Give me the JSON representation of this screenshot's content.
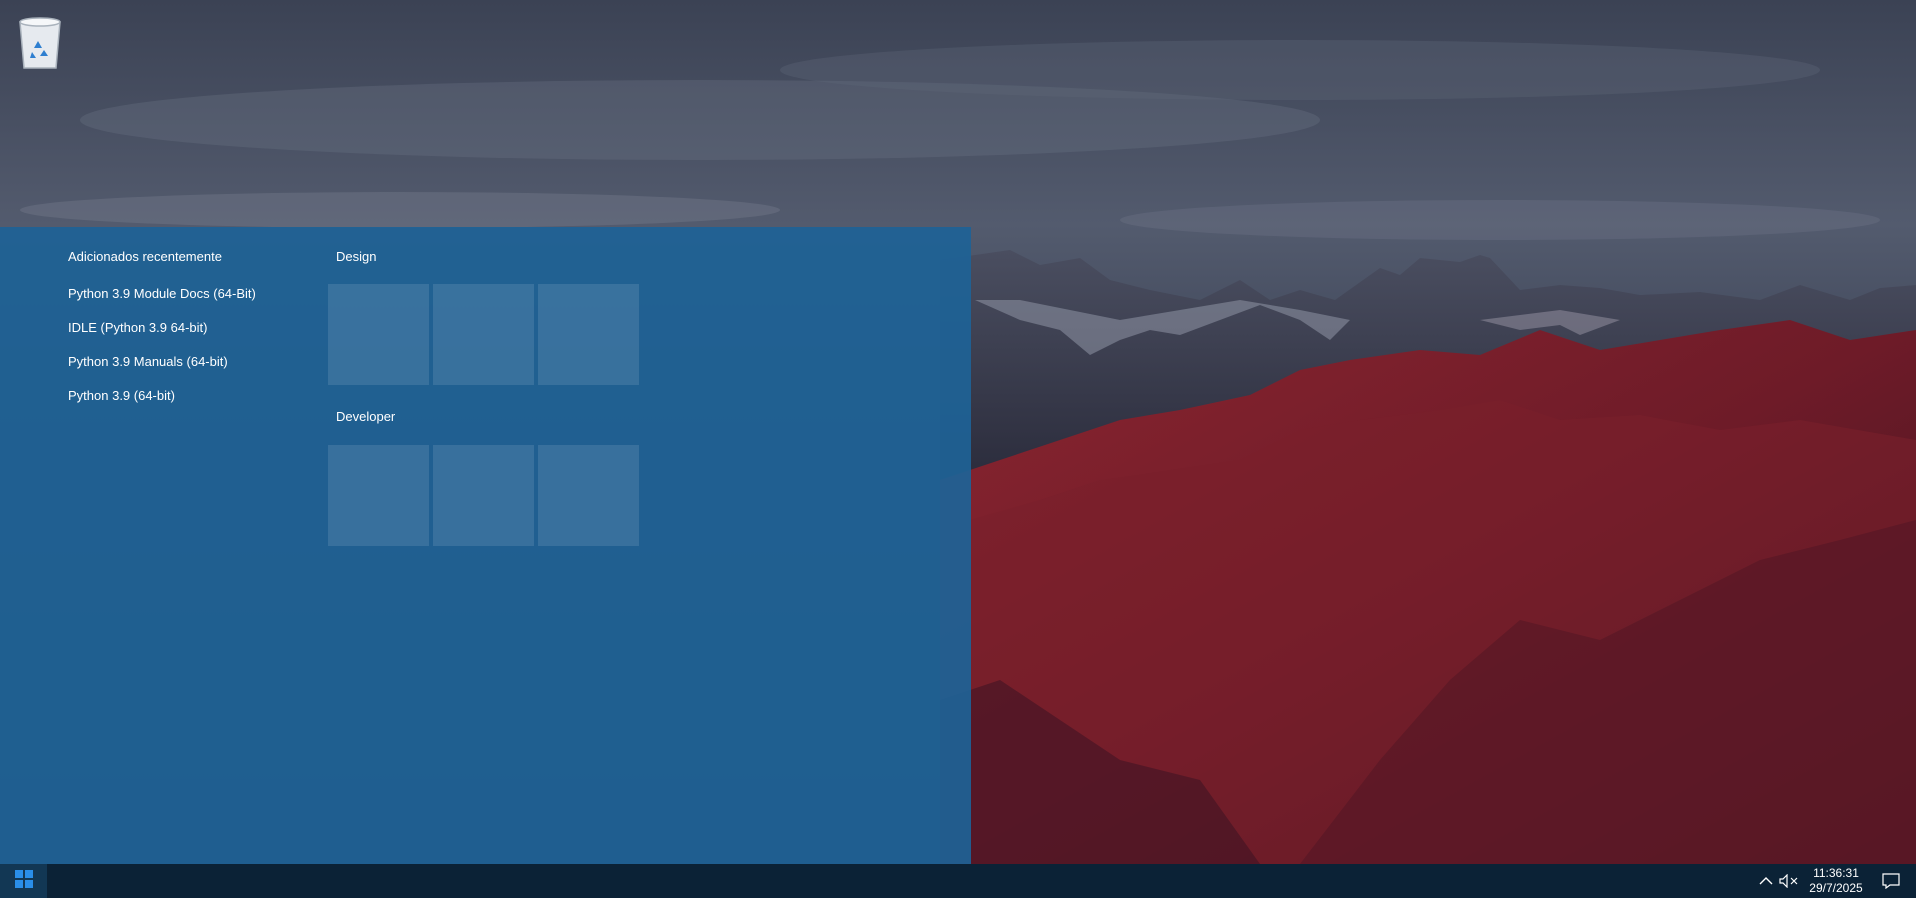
{
  "desktop": {
    "icons": [
      {
        "name": "recycle-bin",
        "icon": "recycle-bin-icon"
      }
    ]
  },
  "start_menu": {
    "recent_header": "Adicionados recentemente",
    "recent_items": [
      {
        "label": "Python 3.9 Module Docs (64-Bit)"
      },
      {
        "label": "IDLE (Python 3.9 64-bit)"
      },
      {
        "label": "Python 3.9 Manuals (64-bit)"
      },
      {
        "label": "Python 3.9 (64-bit)"
      }
    ],
    "groups": [
      {
        "title": "Design",
        "tile_count": 3
      },
      {
        "title": "Developer",
        "tile_count": 3
      }
    ],
    "background_color": "#1e6296"
  },
  "taskbar": {
    "start_icon": "windows-logo-icon",
    "tray": {
      "chevron_icon": "chevron-up-icon",
      "volume_icon": "speaker-muted-icon",
      "time": "11:36:31",
      "date": "29/7/2025",
      "notification_icon": "action-center-icon"
    },
    "accent_color": "#0b2236"
  }
}
